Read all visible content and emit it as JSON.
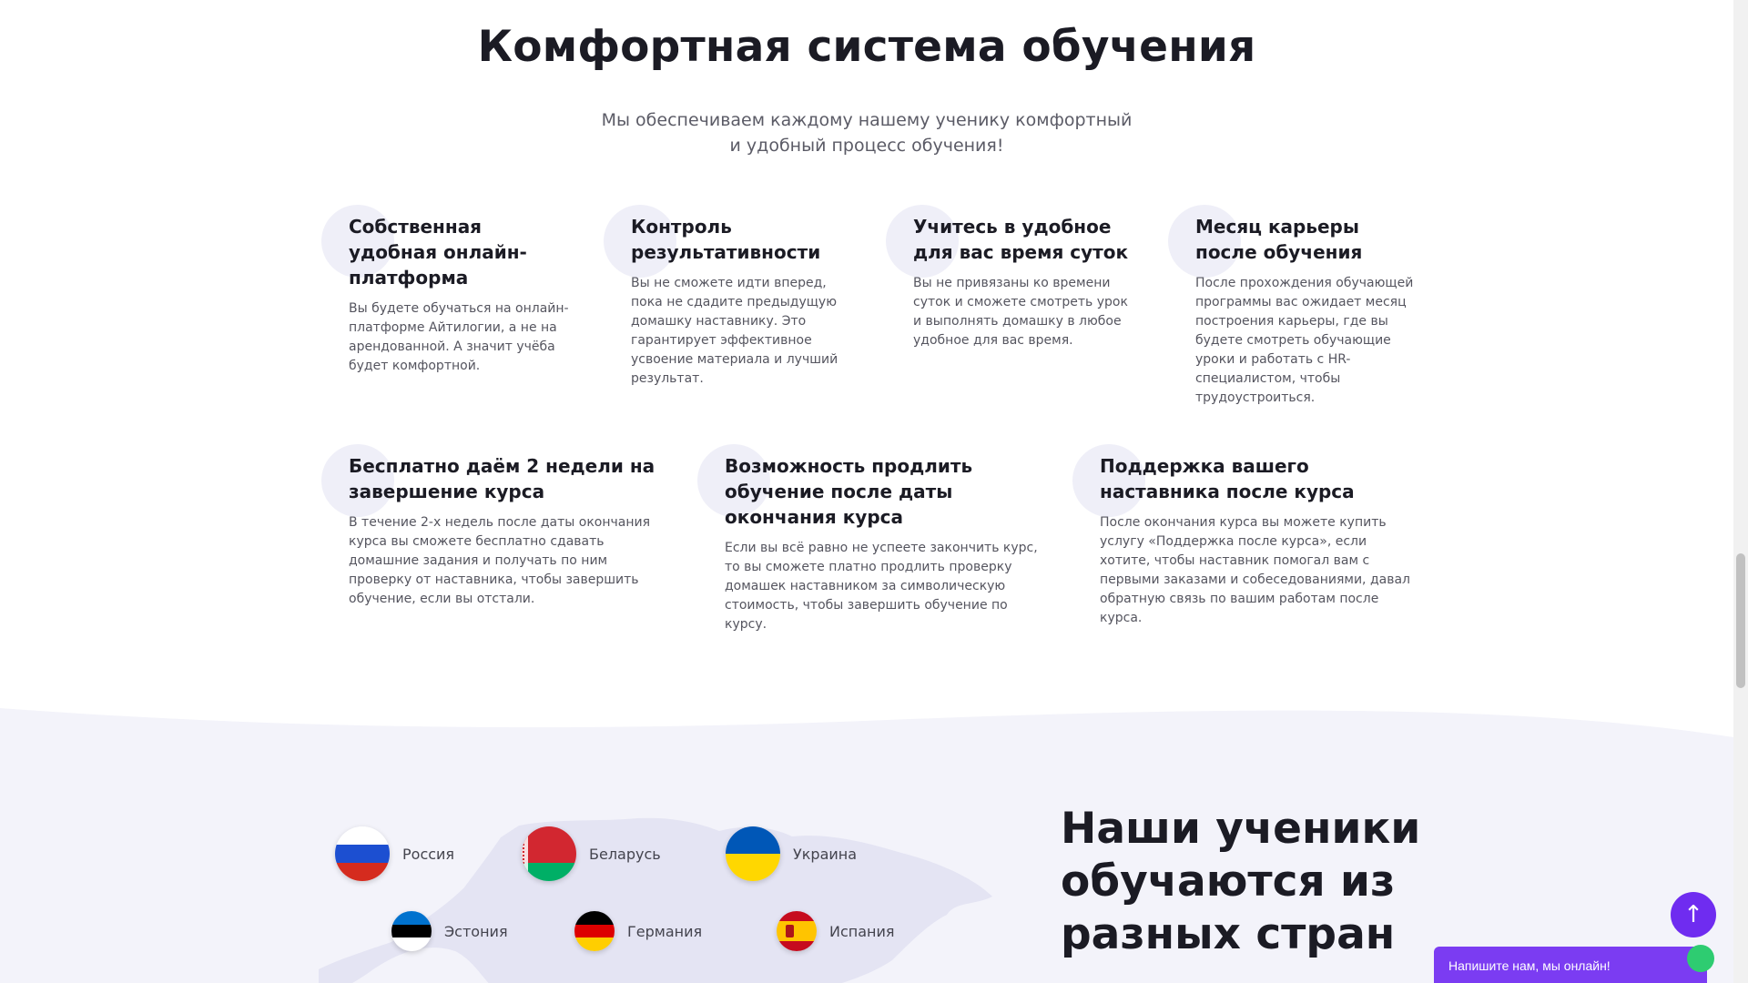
{
  "header": {
    "title": "Комфортная система обучения",
    "subtitle_line1": "Мы обеспечиваем каждому нашему ученику комфортный",
    "subtitle_line2": "и удобный процесс обучения!"
  },
  "features_row1": [
    {
      "title": "Собственная удобная онлайн-платформа",
      "text": "Вы будете обучаться на онлайн-платформе Айтилогии, а не на арендованной. А значит учёба будет комфортной."
    },
    {
      "title": "Контроль результативности",
      "text": "Вы не сможете идти вперед, пока не сдадите предыдущую домашку наставнику. Это гарантирует эффективное усвоение материала и лучший результат."
    },
    {
      "title": "Учитесь в удобное для вас время суток",
      "text": "Вы не привязаны ко времени суток и сможете смотреть урок и выполнять домашку в любое удобное для вас время."
    },
    {
      "title": "Месяц карьеры после обучения",
      "text": "После прохождения обучающей программы вас ожидает месяц построения карьеры, где вы будете смотреть обучающие уроки и работать с HR-специалистом, чтобы трудоустроиться."
    }
  ],
  "features_row2": [
    {
      "title": "Бесплатно даём 2 недели на завершение курса",
      "text": "В течение 2-х недель после даты окончания курса вы сможете бесплатно сдавать домашние задания и получать по ним проверку от наставника, чтобы завершить обучение, если вы отстали."
    },
    {
      "title": "Возможность продлить обучение после даты окончания курса",
      "text": "Если вы всё равно не успеете закончить курс, то вы сможете платно продлить проверку домашек наставником за символическую стоимость, чтобы завершить обучение по курсу."
    },
    {
      "title": "Поддержка вашего наставника после курса",
      "text": "После окончания курса вы можете купить услугу «Поддержка после курса», если хотите, чтобы наставник помогал вам с первыми заказами и собеседованиями, давал обратную связь по вашим работам после курса."
    }
  ],
  "countries": [
    {
      "name": "Россия",
      "icon": "russia-flag-icon",
      "colors": [
        "#ffffff",
        "#1c4fd1",
        "#d52b1e"
      ]
    },
    {
      "name": "Беларусь",
      "icon": "belarus-flag-icon",
      "colors": [
        "#d22730",
        "#00af66"
      ]
    },
    {
      "name": "Украина",
      "icon": "ukraine-flag-icon",
      "colors": [
        "#0057b7",
        "#ffd700"
      ]
    },
    {
      "name": "Эстония",
      "icon": "estonia-flag-icon",
      "colors": [
        "#0072ce",
        "#000000",
        "#ffffff"
      ]
    },
    {
      "name": "Германия",
      "icon": "germany-flag-icon",
      "colors": [
        "#000000",
        "#dd0000",
        "#ffce00"
      ]
    },
    {
      "name": "Испания",
      "icon": "spain-flag-icon",
      "colors": [
        "#c60b1e",
        "#ffc400",
        "#c60b1e"
      ]
    }
  ],
  "students_heading": {
    "line1": "Наши ученики",
    "line2": "обучаются из",
    "line3": "разных стран"
  },
  "scroll_top": {
    "icon": "arrow-up-icon",
    "symbol": "↑"
  },
  "chat": {
    "label": "Напишите нам, мы онлайн!"
  },
  "colors": {
    "accent": "#6f2cf0",
    "chat": "#7b3cf2",
    "section_bg": "#f3f3fa",
    "circle": "#efeff8"
  }
}
